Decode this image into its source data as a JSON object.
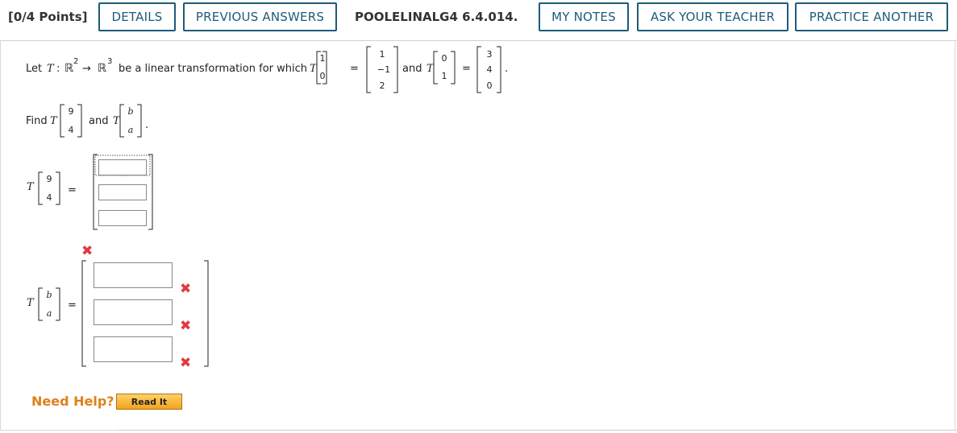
{
  "header": {
    "points": "[0/4 Points]",
    "details": "DETAILS",
    "previous_answers": "PREVIOUS ANSWERS",
    "problem_id": "POOLELINALG4 6.4.014.",
    "my_notes": "MY NOTES",
    "ask_teacher": "ASK YOUR TEACHER",
    "practice_another": "PRACTICE ANOTHER"
  },
  "problem": {
    "intro": "Let",
    "T": "T",
    "colon": ":",
    "R2": "ℝ",
    "exp2": "2",
    "arrow": "→",
    "R3": "ℝ",
    "exp3": "3",
    "intro_rest": "be a linear transformation for which",
    "e1": [
      "1",
      "0"
    ],
    "eq": "=",
    "t_e1": [
      "1",
      "−1",
      "2"
    ],
    "and": "and",
    "e2": [
      "0",
      "1"
    ],
    "t_e2": [
      "3",
      "4",
      "0"
    ],
    "period": ".",
    "find": "Find",
    "v1": [
      "9",
      "4"
    ],
    "v2": [
      "b",
      "a"
    ]
  },
  "answers": {
    "v1_values": [
      "",
      "",
      ""
    ],
    "v2_values": [
      "",
      "",
      ""
    ],
    "status_color": "#e0393e",
    "status_icon": "x-mark-icon"
  },
  "help": {
    "label": "Need Help?",
    "read_it": "Read It"
  }
}
